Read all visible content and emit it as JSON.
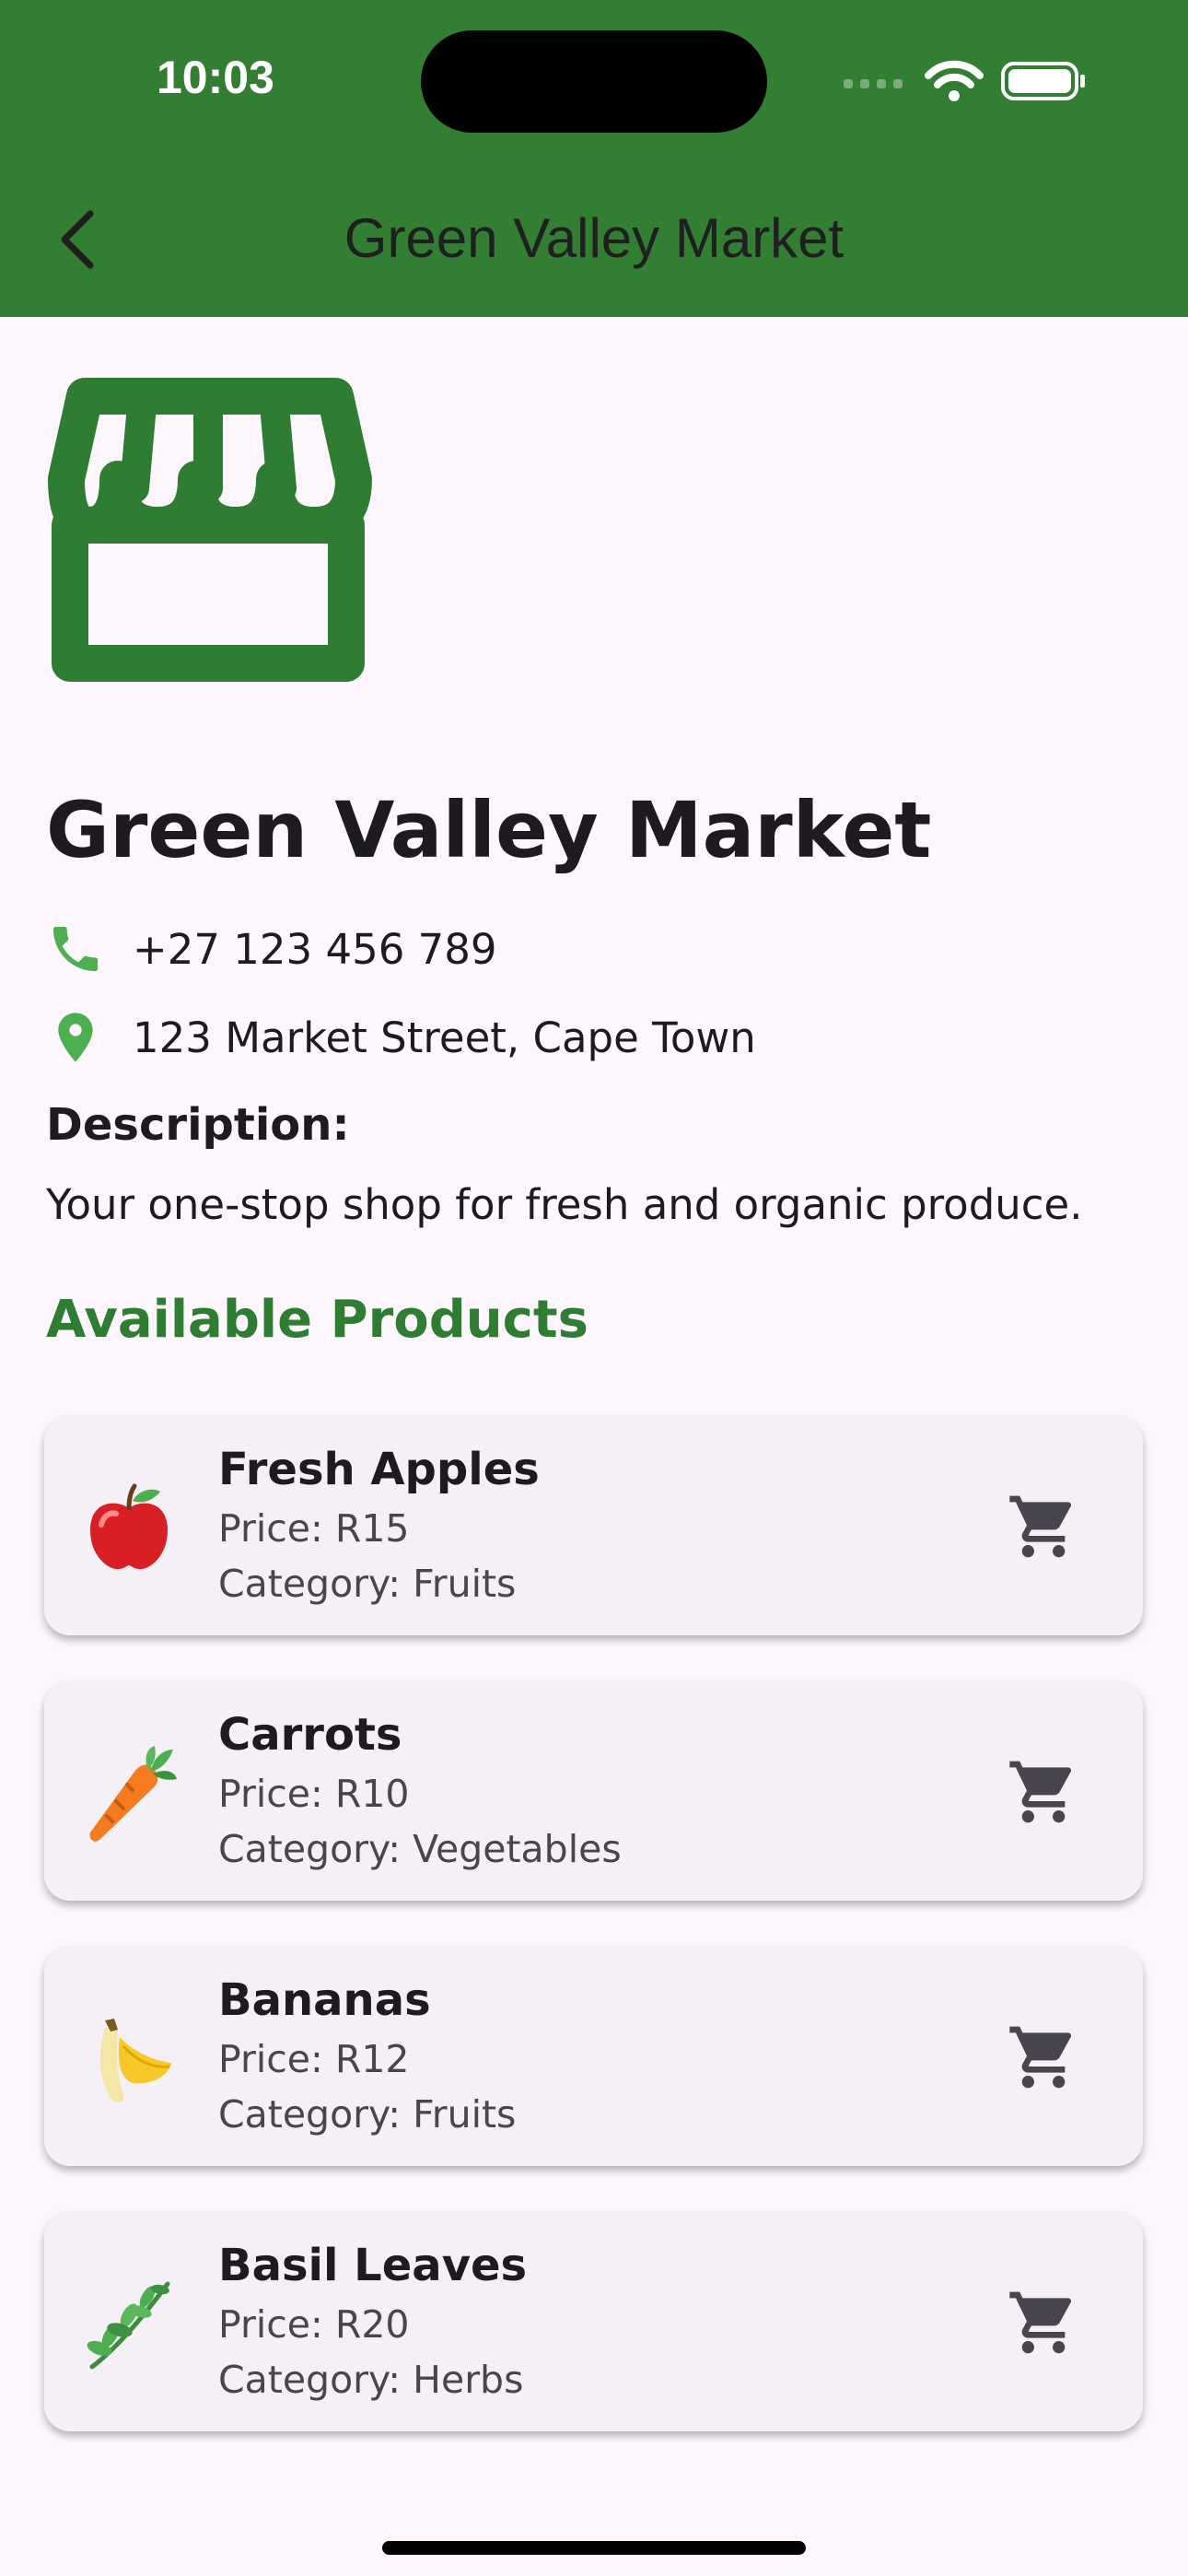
{
  "status_bar": {
    "time": "10:03"
  },
  "app_bar": {
    "title": "Green Valley Market",
    "back_icon": "chevron-left-icon"
  },
  "shop": {
    "name": "Green Valley Market",
    "phone": "+27 123 456 789",
    "address": "123 Market Street, Cape Town",
    "description_label": "Description:",
    "description": "Your one-stop shop for fresh and organic produce."
  },
  "products_title": "Available Products",
  "products": [
    {
      "name": "Fresh Apples",
      "price": "Price: R15",
      "category": "Category: Fruits",
      "icon": "apple-icon"
    },
    {
      "name": "Carrots",
      "price": "Price: R10",
      "category": "Category: Vegetables",
      "icon": "carrot-icon"
    },
    {
      "name": "Bananas",
      "price": "Price: R12",
      "category": "Category: Fruits",
      "icon": "banana-icon"
    },
    {
      "name": "Basil Leaves",
      "price": "Price: R20",
      "category": "Category: Herbs",
      "icon": "herb-icon"
    }
  ],
  "colors": {
    "app_bar": "#327e32",
    "accent_green": "#2e7d32",
    "icon_green": "#4caf50",
    "background": "#fdf7fd",
    "card": "#f4f0f5"
  }
}
